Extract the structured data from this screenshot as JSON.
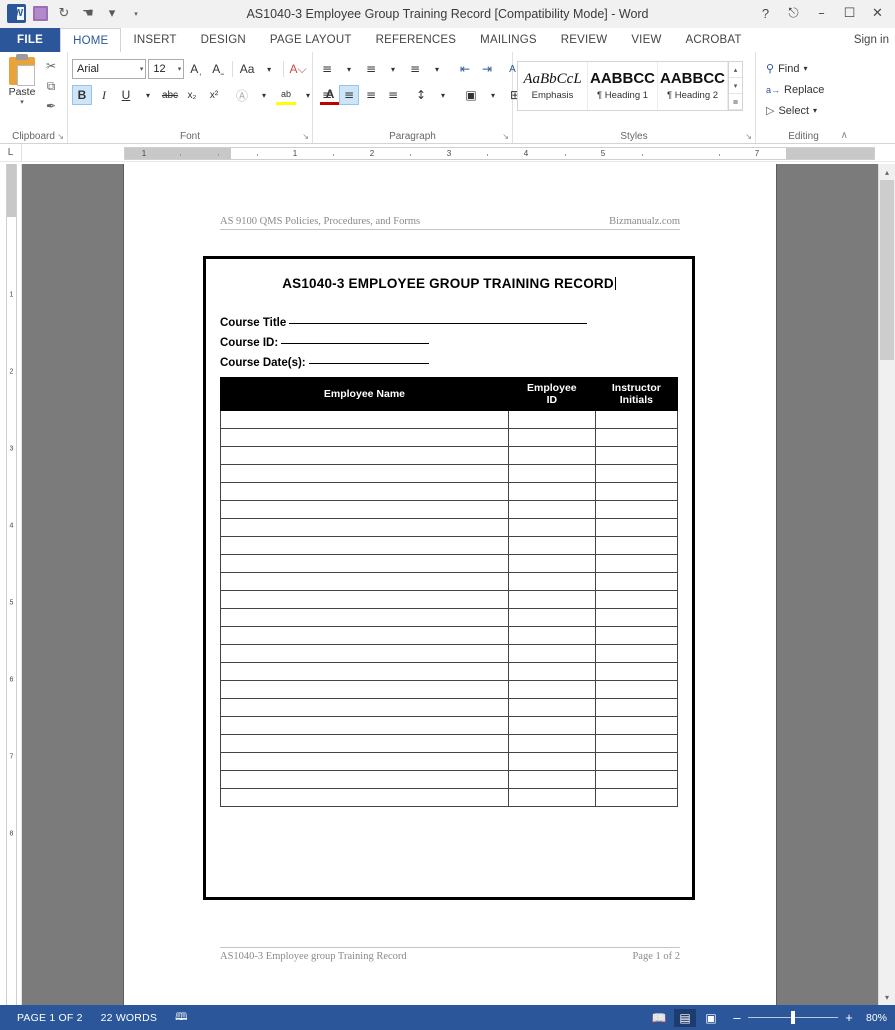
{
  "window": {
    "title": "AS1040-3 Employee Group Training Record [Compatibility Mode] - Word",
    "help_icon": "?",
    "ribbon_display_icon": "ribbon-options",
    "minimize_icon": "–",
    "maximize_icon": "❐",
    "close_icon": "✕",
    "signin_label": "Sign in"
  },
  "quick_access": {
    "app_icon": "word-logo",
    "items": [
      {
        "name": "save-icon",
        "glyph": "▤"
      },
      {
        "name": "undo-icon",
        "glyph": "↶"
      },
      {
        "name": "redo-icon",
        "glyph": "↻"
      },
      {
        "name": "touch-mode-icon",
        "glyph": "☚"
      },
      {
        "name": "customize-qat-icon",
        "glyph": "▾"
      }
    ]
  },
  "tabs": {
    "file_label": "FILE",
    "items": [
      {
        "label": "HOME",
        "active": true
      },
      {
        "label": "INSERT",
        "active": false
      },
      {
        "label": "DESIGN",
        "active": false
      },
      {
        "label": "PAGE LAYOUT",
        "active": false
      },
      {
        "label": "REFERENCES",
        "active": false
      },
      {
        "label": "MAILINGS",
        "active": false
      },
      {
        "label": "REVIEW",
        "active": false
      },
      {
        "label": "VIEW",
        "active": false
      },
      {
        "label": "ACROBAT",
        "active": false
      }
    ]
  },
  "ribbon": {
    "clipboard": {
      "label": "Clipboard",
      "paste_label": "Paste",
      "dialog_launcher": "↘",
      "cut_icon": "✂",
      "copy_icon": "⧉",
      "format_painter_icon": "✒"
    },
    "font": {
      "label": "Font",
      "dialog_launcher": "↘",
      "font_name": "Arial",
      "font_size": "12",
      "grow_font_icon": "A˄",
      "shrink_font_icon": "Aˇ",
      "change_case_icon": "Aa",
      "clear_formatting_icon": "A✗",
      "bold_label": "B",
      "italic_label": "I",
      "underline_label": "U",
      "strikethrough_label": "abc",
      "subscript_label": "x₂",
      "superscript_label": "x²",
      "text_effects_icon": "A",
      "highlight_icon": "ab",
      "font_color_icon": "A"
    },
    "paragraph": {
      "label": "Paragraph",
      "dialog_launcher": "↘",
      "bullets_icon": "≣",
      "numbering_icon": "≣",
      "multilevel_icon": "≣",
      "decrease_indent_icon": "⬅",
      "increase_indent_icon": "➡",
      "sort_icon": "A↓",
      "show_marks_icon": "¶",
      "align_left_icon": "≡",
      "align_center_icon": "≡",
      "align_right_icon": "≡",
      "justify_icon": "≡",
      "line_spacing_icon": "↕",
      "shading_icon": "▣",
      "borders_icon": "⊞"
    },
    "styles": {
      "label": "Styles",
      "dialog_launcher": "↘",
      "items": [
        {
          "preview": "AaBbCcL",
          "name": "Emphasis"
        },
        {
          "preview": "AABBCC",
          "name": "¶ Heading 1"
        },
        {
          "preview": "AABBCC",
          "name": "¶ Heading 2"
        }
      ],
      "scroll_up": "▴",
      "scroll_down": "▾",
      "more": "≣"
    },
    "editing": {
      "label": "Editing",
      "find_label": "Find",
      "find_icon": "🔍",
      "replace_label": "Replace",
      "replace_icon": "ab",
      "select_label": "Select",
      "select_icon": "↖",
      "collapse_ribbon_icon": "∧"
    }
  },
  "ruler": {
    "corner_tab_icon": "L",
    "horizontal_ticks": [
      "1",
      "1",
      "2",
      "3",
      "4",
      "5",
      "7"
    ],
    "vertical_ticks": [
      "1",
      "2",
      "3",
      "4",
      "5",
      "6",
      "7",
      "8"
    ]
  },
  "document": {
    "header_left": "AS 9100 QMS Policies, Procedures, and Forms",
    "header_right": "Bizmanualz.com",
    "form_title": "AS1040-3 EMPLOYEE GROUP TRAINING RECORD",
    "fields": [
      {
        "label": "Course Title",
        "value": "",
        "blank_width": 298
      },
      {
        "label": "Course ID:",
        "value": "",
        "blank_width": 148
      },
      {
        "label": "Course Date(s):",
        "value": "",
        "blank_width": 120
      }
    ],
    "table": {
      "columns": [
        "Employee Name",
        "Employee ID",
        "Instructor Initials"
      ],
      "column_lines": [
        [
          "Employee Name"
        ],
        [
          "Employee",
          "ID"
        ],
        [
          "Instructor",
          "Initials"
        ]
      ],
      "row_count": 22,
      "rows": []
    },
    "footer_left": "AS1040-3 Employee group Training Record",
    "footer_right": "Page 1 of 2"
  },
  "status_bar": {
    "page_label": "PAGE 1 OF 2",
    "word_count": "22 WORDS",
    "proofing_icon": "📖",
    "views": [
      {
        "name": "read-mode-icon",
        "glyph": "📖",
        "selected": false
      },
      {
        "name": "print-layout-icon",
        "glyph": "▤",
        "selected": true
      },
      {
        "name": "web-layout-icon",
        "glyph": "▥",
        "selected": false
      }
    ],
    "zoom_out_icon": "–",
    "zoom_in_icon": "+",
    "zoom_level": "80%"
  },
  "scrollbar": {
    "up_arrow": "▴",
    "down_arrow": "▾"
  },
  "colors": {
    "accent": "#2b579a",
    "ribbon_bg": "#ffffff",
    "titlebar_bg": "#f1f1f1",
    "canvas_bg": "#7b7b7b",
    "table_header_bg": "#000000"
  }
}
